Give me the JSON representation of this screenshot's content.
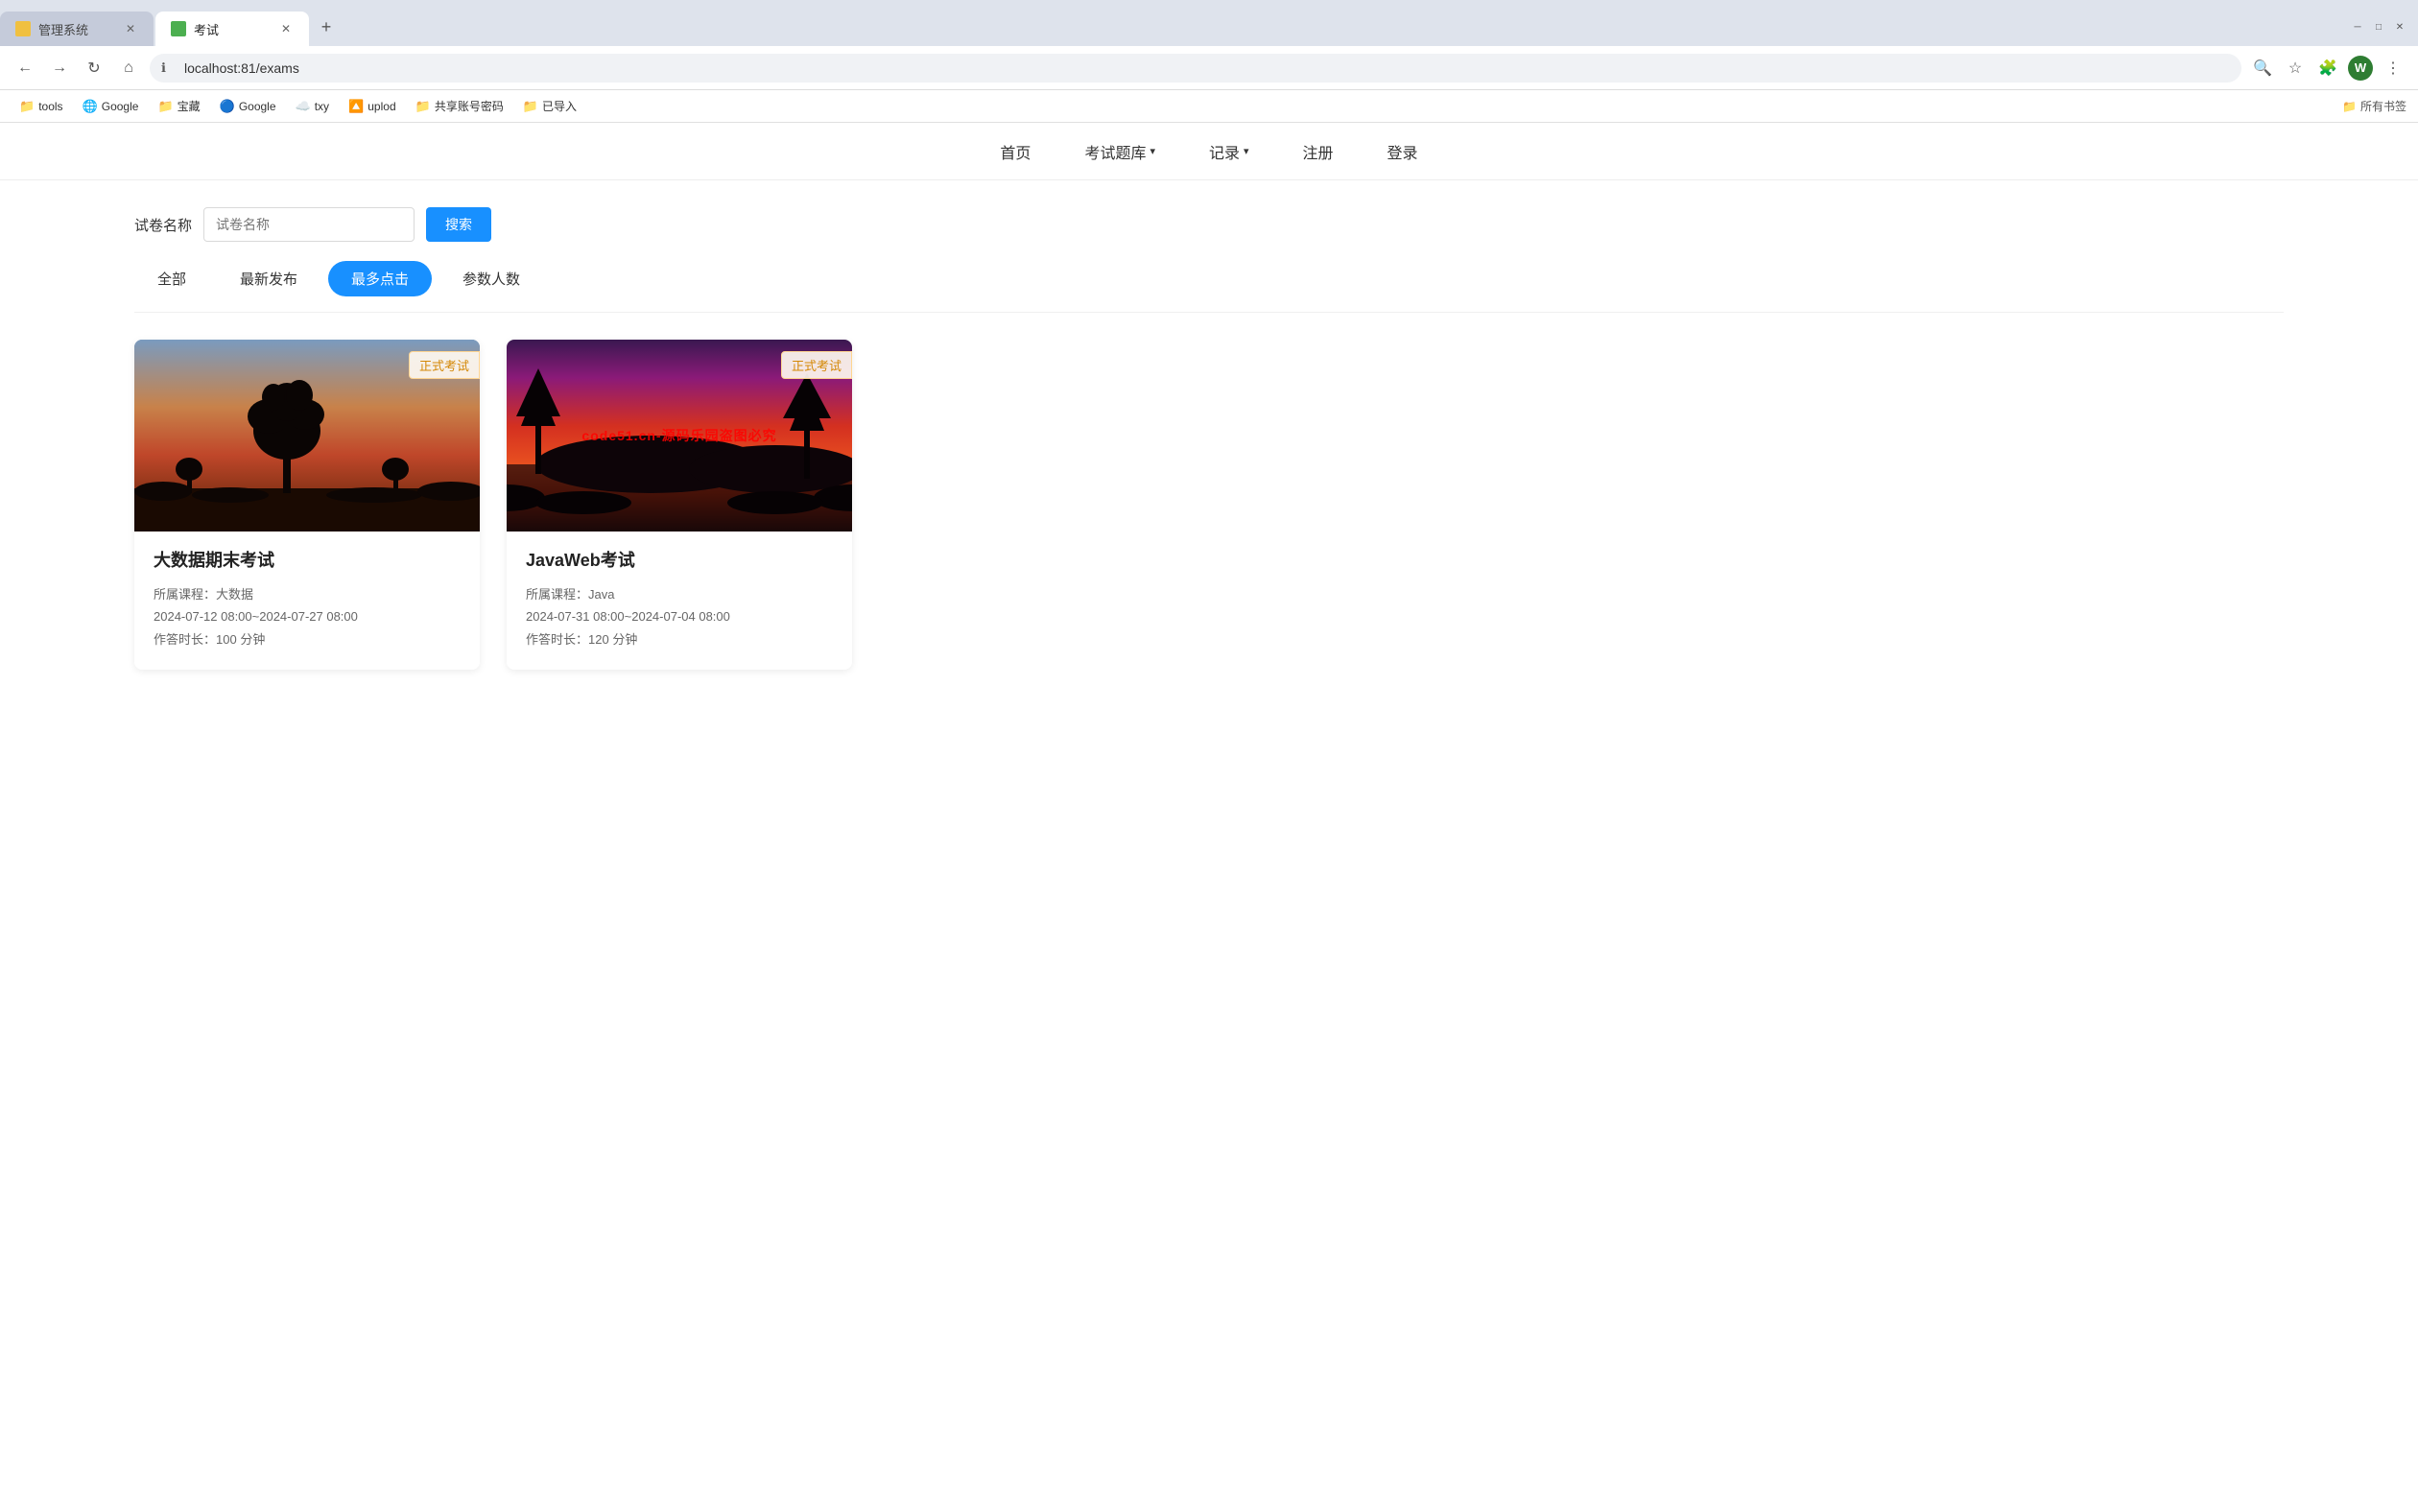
{
  "browser": {
    "tabs": [
      {
        "id": "tab1",
        "title": "管理系统",
        "icon_color": "yellow",
        "active": false
      },
      {
        "id": "tab2",
        "title": "考试",
        "icon_color": "green",
        "active": true
      }
    ],
    "address": "localhost:81/exams",
    "avatar_letter": "W"
  },
  "bookmarks": [
    {
      "id": "bm1",
      "label": "tools",
      "icon": "📁"
    },
    {
      "id": "bm2",
      "label": "Google",
      "icon": "🌐"
    },
    {
      "id": "bm3",
      "label": "宝藏",
      "icon": "📁"
    },
    {
      "id": "bm4",
      "label": "Google",
      "icon": "🔵"
    },
    {
      "id": "bm5",
      "label": "txy",
      "icon": "☁️"
    },
    {
      "id": "bm6",
      "label": "uplod",
      "icon": "🔼"
    },
    {
      "id": "bm7",
      "label": "共享账号密码",
      "icon": "📁"
    },
    {
      "id": "bm8",
      "label": "已导入",
      "icon": "📁"
    }
  ],
  "bookmarks_right": "所有书签",
  "nav": {
    "items": [
      {
        "id": "nav-home",
        "label": "首页",
        "active": true
      },
      {
        "id": "nav-exam-bank",
        "label": "考试题库",
        "has_arrow": true
      },
      {
        "id": "nav-record",
        "label": "记录",
        "has_arrow": true
      },
      {
        "id": "nav-register",
        "label": "注册"
      },
      {
        "id": "nav-login",
        "label": "登录"
      }
    ]
  },
  "search": {
    "label": "试卷名称",
    "placeholder": "试卷名称",
    "button_label": "搜索"
  },
  "filters": {
    "items": [
      {
        "id": "filter-all",
        "label": "全部",
        "active": false
      },
      {
        "id": "filter-latest",
        "label": "最新发布",
        "active": false
      },
      {
        "id": "filter-popular",
        "label": "最多点击",
        "active": true
      },
      {
        "id": "filter-participants",
        "label": "参数人数",
        "active": false
      }
    ]
  },
  "exams": [
    {
      "id": "exam1",
      "title": "大数据期末考试",
      "badge": "正式考试",
      "course_label": "所属课程：",
      "course": "大数据",
      "time_range": "2024-07-12 08:00~2024-07-27 08:00",
      "duration_label": "作答时长：",
      "duration": "100 分钟",
      "image_type": "sunset1"
    },
    {
      "id": "exam2",
      "title": "JavaWeb考试",
      "badge": "正式考试",
      "course_label": "所属课程：",
      "course": "Java",
      "time_range": "2024-07-31 08:00~2024-07-04 08:00",
      "duration_label": "作答时长：",
      "duration": "120 分钟",
      "image_type": "sunset2",
      "watermark": "code51.cn-源码乐园盗图必究"
    }
  ]
}
